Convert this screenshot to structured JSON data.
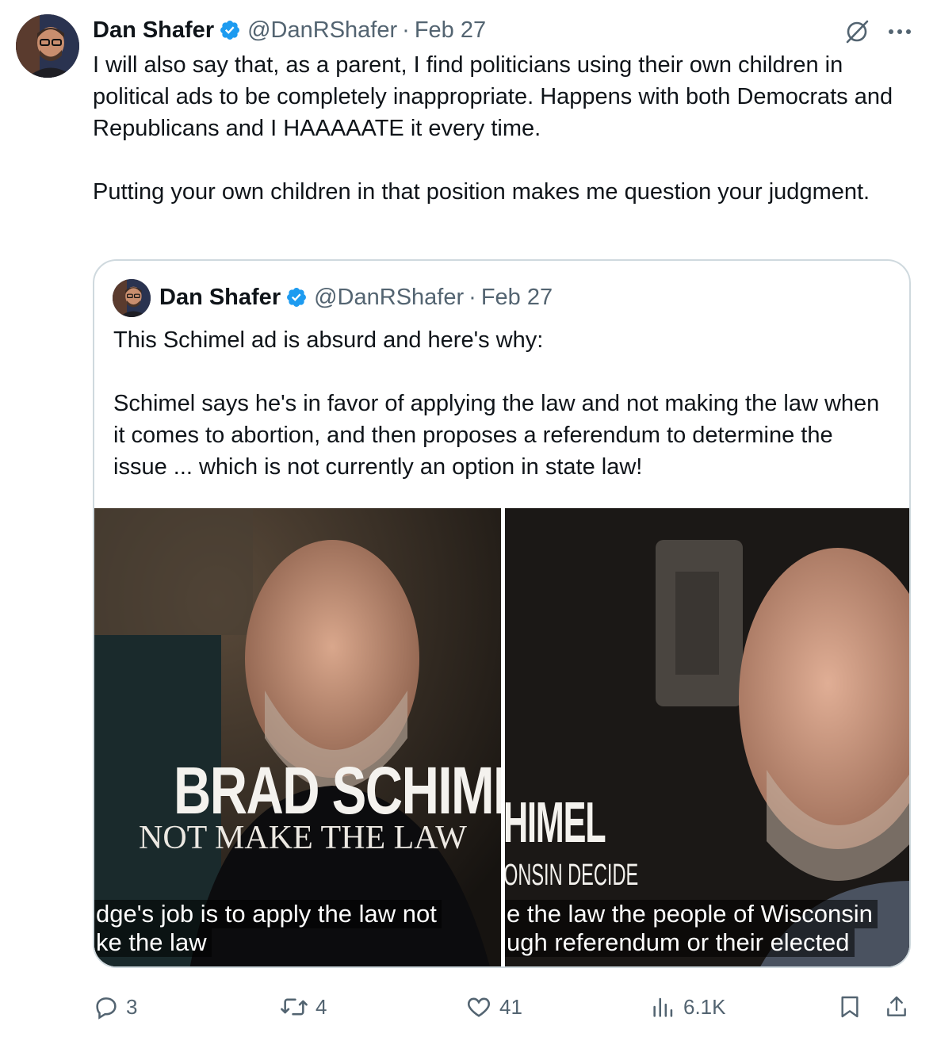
{
  "tweet": {
    "author_name": "Dan Shafer",
    "handle": "@DanRShafer",
    "separator": "·",
    "date": "Feb 27",
    "text": "I will also say that, as a parent, I find politicians using their own children in political ads to be completely inappropriate. Happens with both Democrats and Republicans and I HAAAAATE it every time.\n\nPutting your own children in that position makes me question your judgment."
  },
  "quote": {
    "author_name": "Dan Shafer",
    "handle": "@DanRShafer",
    "separator": "·",
    "date": "Feb 27",
    "text": "This Schimel ad is absurd and here's why:\n\nSchimel says he's in favor of applying the law and not making the law when it comes to abortion, and then proposes a referendum to determine the issue ... which is not currently an option in state law!",
    "media_left": {
      "title": "BRAD SCHIMEL",
      "subtitle": "NOT MAKE THE LAW",
      "caption_line1": "dge's job is to apply the law not",
      "caption_line2": "ke the law"
    },
    "media_right": {
      "title": "HIMEL",
      "subtitle": "ONSIN DECIDE",
      "caption_line1": "e the law the people of Wisconsin",
      "caption_line2": "ugh referendum or their elected"
    }
  },
  "actions": {
    "replies": "3",
    "reposts": "4",
    "likes": "41",
    "views": "6.1K"
  },
  "colors": {
    "verified": "#1d9bf0",
    "muted": "#536471",
    "border": "#cfd9de"
  }
}
